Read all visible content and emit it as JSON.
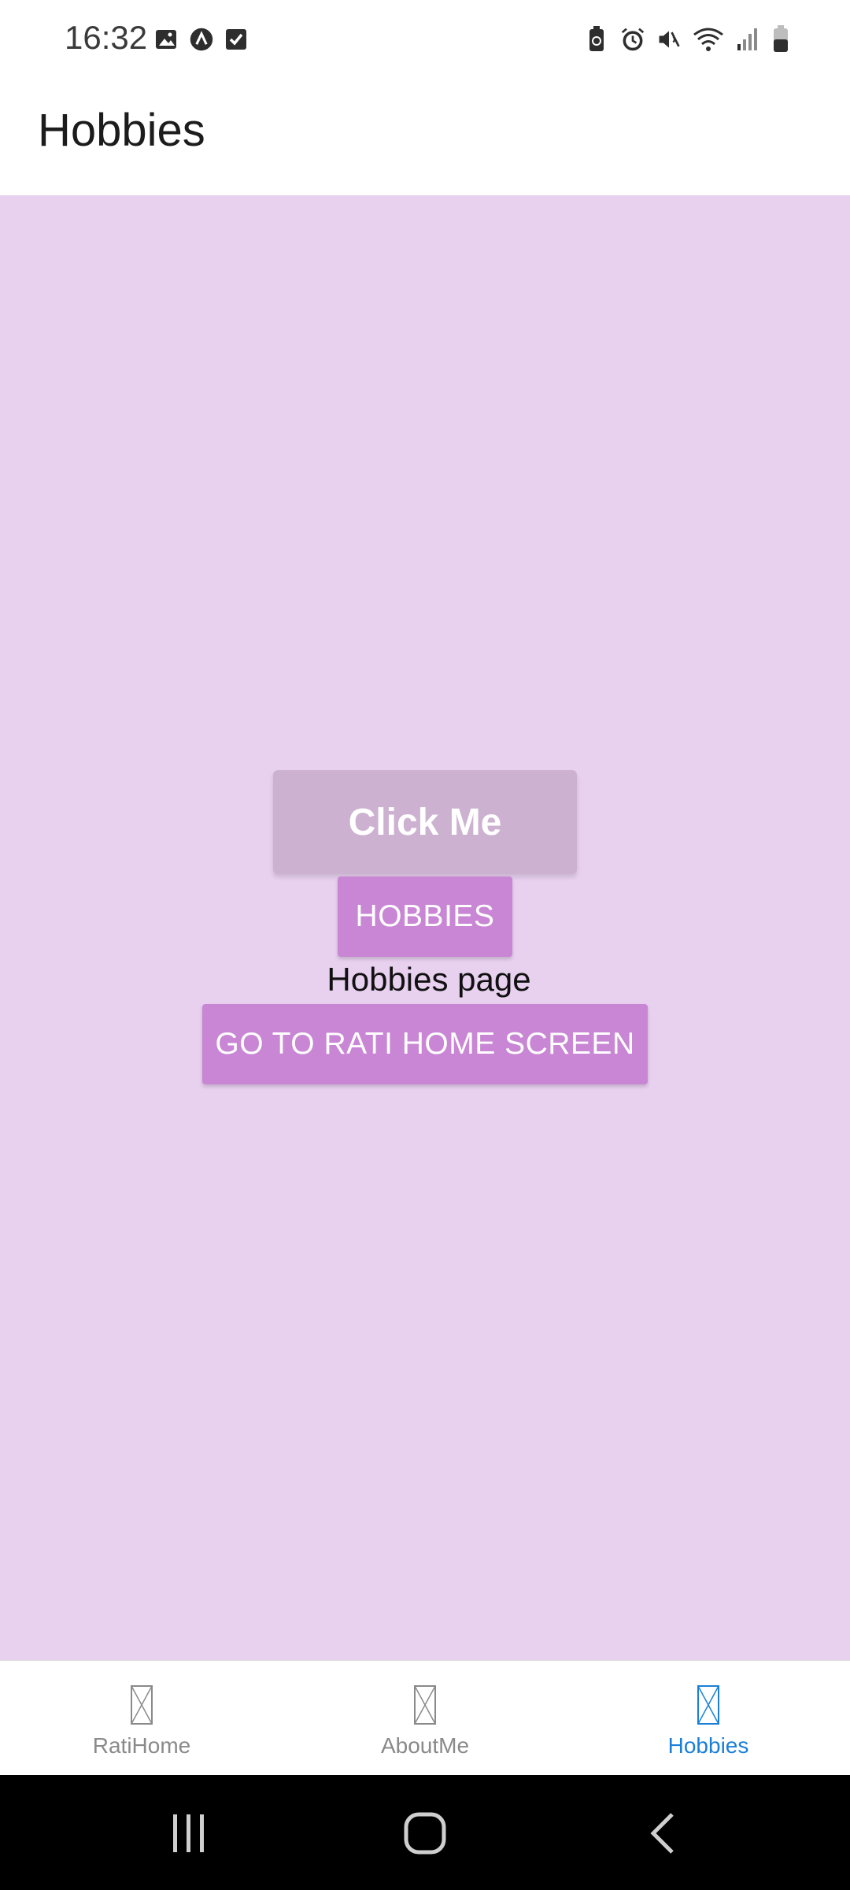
{
  "status_bar": {
    "time": "16:32",
    "left_icons": [
      "image-icon",
      "app-a-icon",
      "checkbox-icon"
    ],
    "right_icons": [
      "battery-saver-icon",
      "alarm-icon",
      "mute-icon",
      "wifi-icon",
      "signal-icon",
      "battery-icon"
    ]
  },
  "app_bar": {
    "title": "Hobbies"
  },
  "main": {
    "click_me_label": "Click Me",
    "hobbies_button_label": "HOBBIES",
    "page_text": "Hobbies page",
    "home_button_label": "GO TO RATI HOME SCREEN"
  },
  "tabs": [
    {
      "label": "RatiHome",
      "active": false
    },
    {
      "label": "AboutMe",
      "active": false
    },
    {
      "label": "Hobbies",
      "active": true
    }
  ],
  "colors": {
    "background": "#e8d0ef",
    "button": "#c886d4",
    "disabled_button": "#cdb1d1",
    "active_tab": "#1a7fd8"
  }
}
